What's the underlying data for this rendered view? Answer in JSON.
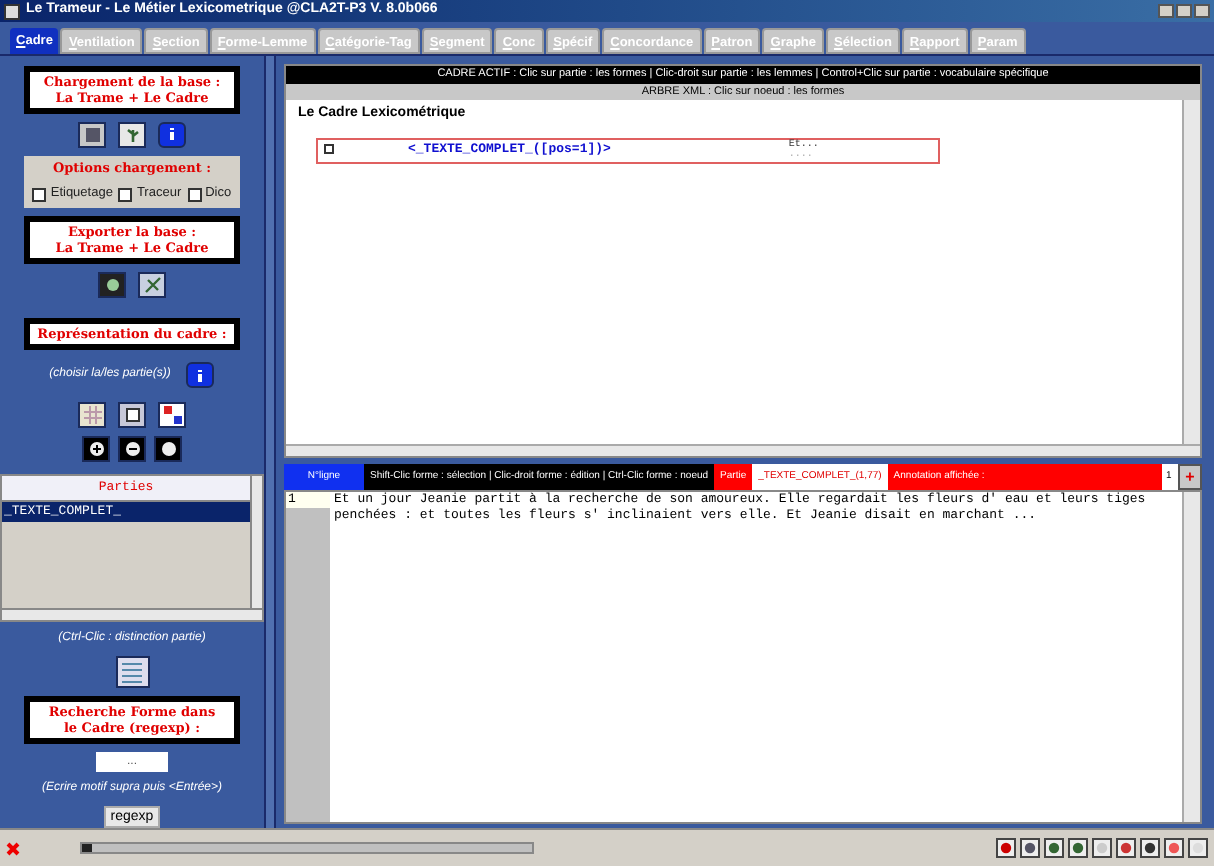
{
  "window": {
    "title": "Le Trameur - Le Métier Lexicometrique @CLA2T-P3 V. 8.0b066"
  },
  "tabs": [
    {
      "label": "Cadre",
      "selected": true
    },
    {
      "label": "Ventilation",
      "selected": false
    },
    {
      "label": "Section",
      "selected": false
    },
    {
      "label": "Forme-Lemme",
      "selected": false
    },
    {
      "label": "Catégorie-Tag",
      "selected": false
    },
    {
      "label": "Segment",
      "selected": false
    },
    {
      "label": "Conc",
      "selected": false
    },
    {
      "label": "Spécif",
      "selected": false
    },
    {
      "label": "Concordance",
      "selected": false
    },
    {
      "label": "Patron",
      "selected": false
    },
    {
      "label": "Graphe",
      "selected": false
    },
    {
      "label": "Sélection",
      "selected": false
    },
    {
      "label": "Rapport",
      "selected": false
    },
    {
      "label": "Param",
      "selected": false
    }
  ],
  "sidebar": {
    "load_title": "Chargement de la base :\nLa Trame + Le Cadre",
    "options_title": "Options chargement :",
    "options": [
      {
        "label": "Etiquetage",
        "checked": false
      },
      {
        "label": "Traceur",
        "checked": false
      },
      {
        "label": "Dico",
        "checked": false
      }
    ],
    "export_title": "Exporter la base :\nLa Trame + Le Cadre",
    "representation_title": "Représentation du cadre :",
    "representation_hint": "(choisir la/les partie(s))",
    "parts_header": "Parties",
    "parts": [
      {
        "label": "_TEXTE_COMPLET_",
        "selected": true
      }
    ],
    "parts_hint": "(Ctrl-Clic : distinction partie)",
    "search_title": "Recherche Forme dans\nle Cadre (regexp) :",
    "search_value": "...",
    "search_hint": "(Ecrire motif supra puis <Entrée>)",
    "search_button": "regexp"
  },
  "cadre": {
    "header": "CADRE ACTIF : Clic sur partie : les formes | Clic-droit sur partie : les lemmes | Control+Clic sur partie : vocabulaire spécifique",
    "subheader": "ARBRE XML : Clic sur noeud : les formes",
    "title": "Le Cadre Lexicométrique",
    "node": {
      "checked": false,
      "label": "<_TEXTE_COMPLET_([pos=1])>",
      "preview": "Et...",
      "preview_2": "...."
    }
  },
  "text_bar": {
    "line_label": "N°ligne",
    "hint": "Shift-Clic forme : sélection | Clic-droit forme : édition | Ctrl-Clic forme : noeud",
    "part_label": "Partie",
    "part_value": "_TEXTE_COMPLET_(1,77)",
    "annotation_label": "Annotation affichée :",
    "annotation_value": "1",
    "add_button": "+"
  },
  "text": {
    "lines": [
      {
        "number": "1",
        "content": "Et un jour Jeanie partit à la recherche de son amoureux. Elle regardait les fleurs d' eau et leurs tiges penchées : et toutes les fleurs s' inclinaient vers elle. Et Jeanie disait en marchant ..."
      }
    ]
  },
  "status_bar": {
    "progress": {
      "level": 0.02
    }
  }
}
